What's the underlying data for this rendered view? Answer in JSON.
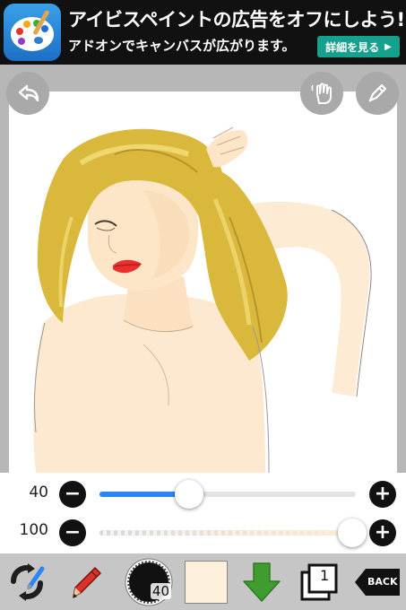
{
  "ad": {
    "title": "アイビスペイントの広告をオフにしよう!",
    "subtitle": "アドオンでキャンバスが広がります。",
    "button_label": "詳細を見る",
    "button_color": "#16a08e"
  },
  "top_buttons": {
    "undo_icon": "undo-arrow-icon",
    "gesture_icon": "hand-gesture-icon",
    "tool_icon": "pen-tool-icon"
  },
  "controls": {
    "brush_size": {
      "value": "40",
      "fraction": 0.35
    },
    "opacity": {
      "value": "100",
      "fraction": 1.0
    }
  },
  "toolbar": {
    "brush_size_badge": "40",
    "current_color": "#fdf1dc",
    "layer_count": "1",
    "back_label": "BACK"
  },
  "colors": {
    "accent": "#2a86f6",
    "download_green": "#3f9c2e",
    "pen_red": "#d8322a"
  }
}
